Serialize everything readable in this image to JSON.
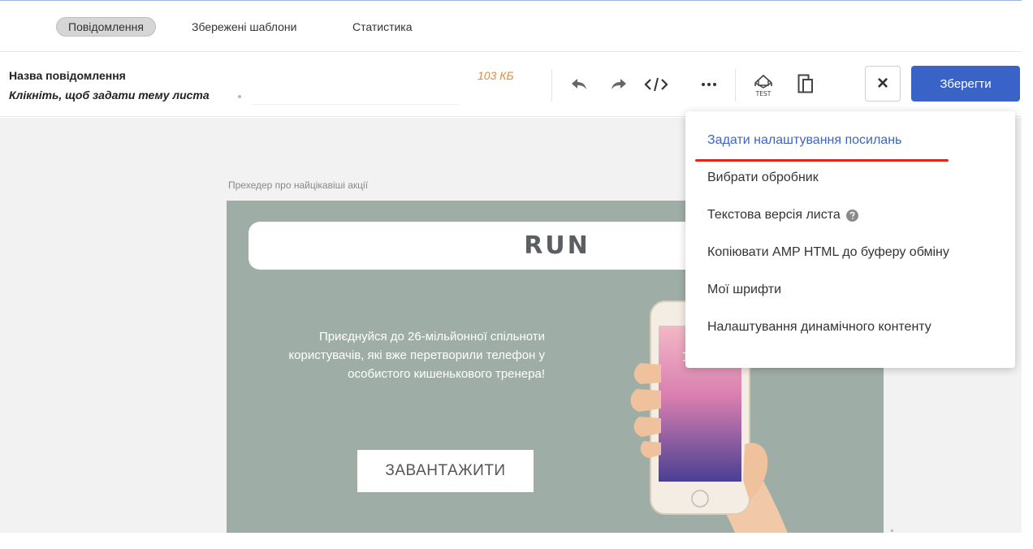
{
  "tabs": [
    {
      "label": "Повідомлення",
      "active": true
    },
    {
      "label": "Збережені шаблони",
      "active": false
    },
    {
      "label": "Статистика",
      "active": false
    }
  ],
  "toolbar": {
    "message_name": "Назва повідомлення",
    "subject_prompt": "Клікніть, щоб задати тему листа",
    "subject_value": "",
    "size": "103 КБ",
    "icons": [
      "undo-icon",
      "redo-icon",
      "code-icon",
      "more-icon",
      "test-email-icon",
      "copy-icon"
    ],
    "test_icon_text": "TEST",
    "close_label": "×",
    "save_label": "Зберегти"
  },
  "email": {
    "preheader": "Прехедер про найцікавіші акції",
    "logo": "RUN",
    "promo_text": "Приєднуйся до 26-мільйонної спільноти користувачів, які вже перетворили телефон у особистого кишенькового тренера!",
    "download_label": "ЗАВАНТАЖИТИ",
    "phone_time": "18"
  },
  "dropdown": {
    "items": [
      {
        "label": "Задати налаштування посилань",
        "highlighted": true
      },
      {
        "label": "Вибрати обробник",
        "highlighted": false
      },
      {
        "label": "Текстова версія листа",
        "highlighted": false,
        "help_icon": true
      },
      {
        "label": "Копіювати AMP HTML до буферу обміну",
        "highlighted": false
      },
      {
        "label": "Мої шрифти",
        "highlighted": false
      },
      {
        "label": "Налаштування динамічного контенту",
        "highlighted": false
      }
    ]
  },
  "colors": {
    "accent": "#3a63c8",
    "size_label": "#e88838",
    "underline": "#e0261c",
    "email_bg": "#9eaea6"
  }
}
